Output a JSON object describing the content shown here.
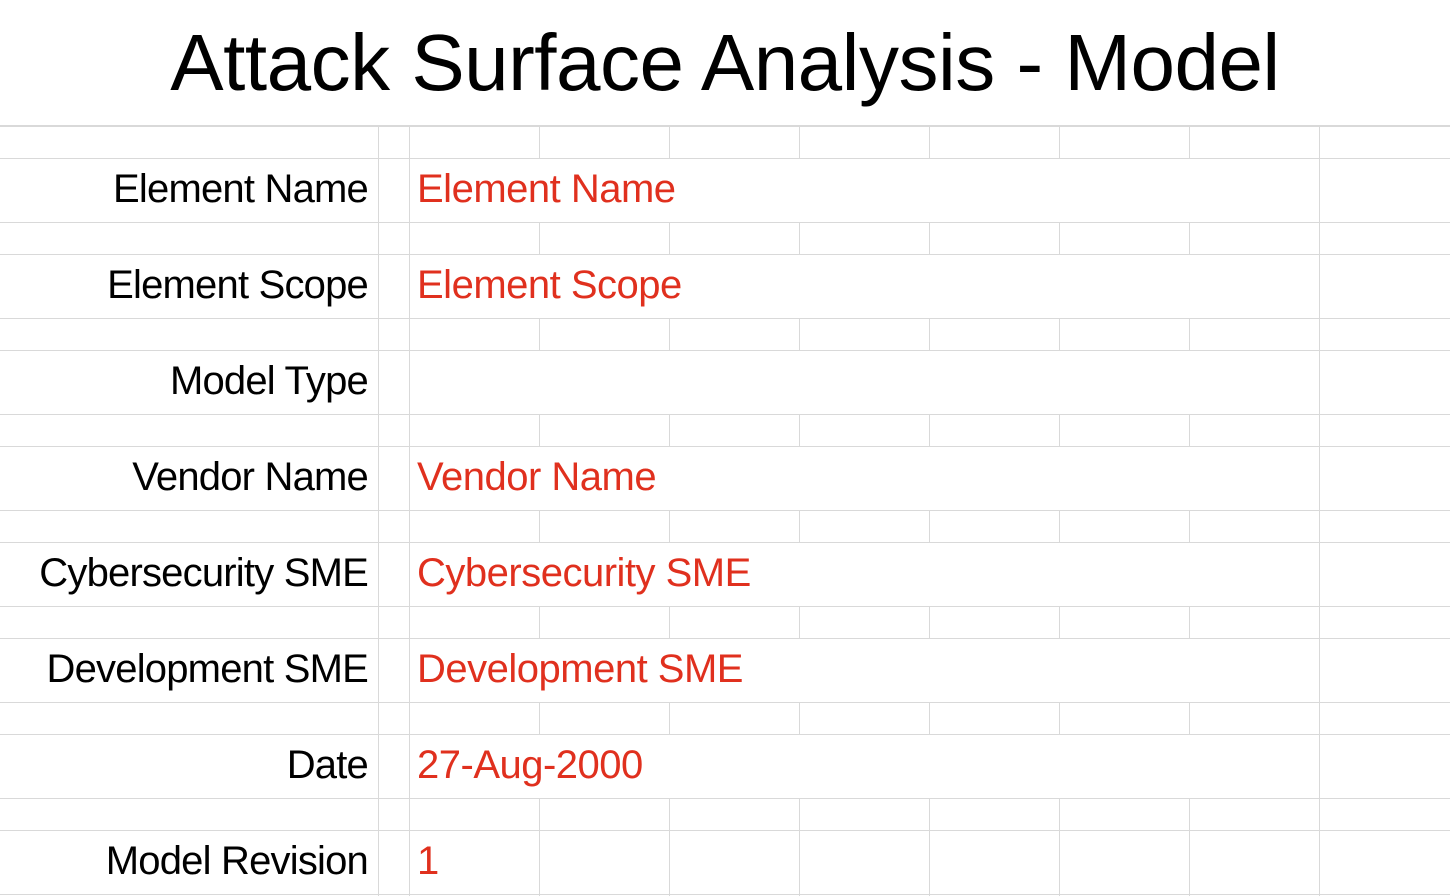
{
  "sheet": {
    "title": "Attack Surface Analysis - Model",
    "value_color": "#e0301e",
    "label_color": "#000000",
    "fields": [
      {
        "label": "Element Name",
        "value": "Element Name"
      },
      {
        "label": "Element Scope",
        "value": "Element Scope"
      },
      {
        "label": "Model Type",
        "value": ""
      },
      {
        "label": "Vendor Name",
        "value": "Vendor Name"
      },
      {
        "label": "Cybersecurity SME",
        "value": "Cybersecurity SME"
      },
      {
        "label": "Development SME",
        "value": "Development SME"
      },
      {
        "label": "Date",
        "value": "27-Aug-2000"
      },
      {
        "label": "Model Revision",
        "value": "1"
      }
    ]
  }
}
